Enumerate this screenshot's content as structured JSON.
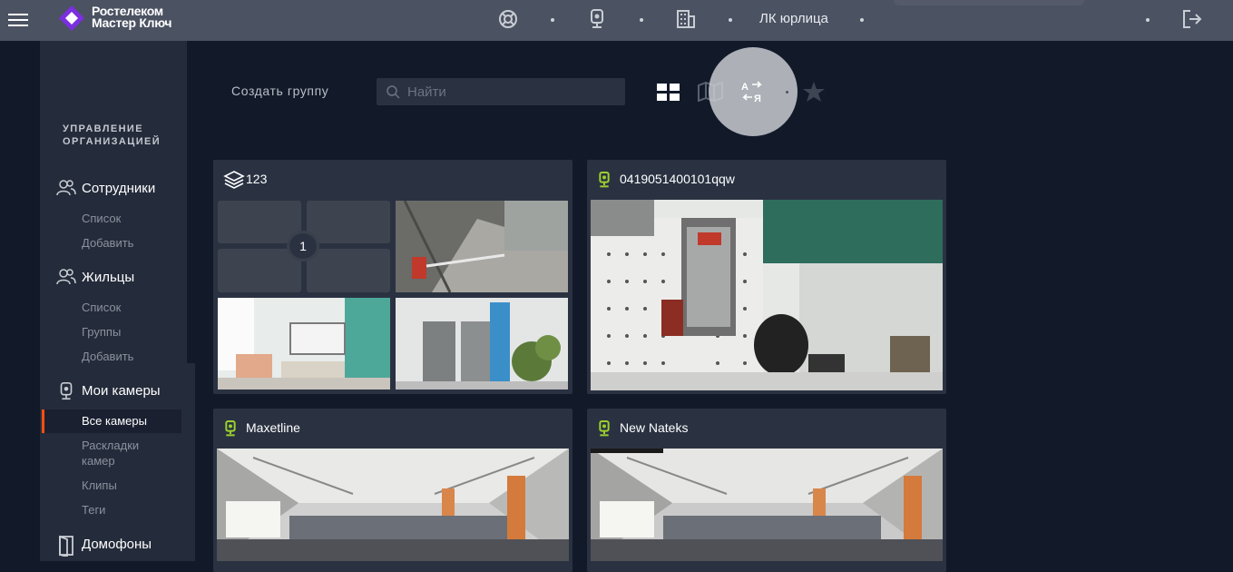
{
  "header": {
    "logo_line1": "Ростелеком",
    "logo_line2": "Мастер Ключ",
    "account_label": "ЛК юрлица",
    "icons": [
      "menu-icon",
      "support-icon",
      "camera-icon",
      "building-icon",
      "logout-icon"
    ]
  },
  "sidebar": {
    "heading": "УПРАВЛЕНИЕ ОРГАНИЗАЦИЕЙ",
    "heading_line1": "УПРАВЛЕНИЕ",
    "heading_line2": "ОРГАНИЗАЦИЕЙ",
    "sections": [
      {
        "label": "Сотрудники",
        "items": [
          "Список",
          "Добавить"
        ]
      },
      {
        "label": "Жильцы",
        "items": [
          "Список",
          "Группы",
          "Добавить"
        ]
      },
      {
        "label": "Мои камеры",
        "items": [
          "Все камеры",
          "Раскладки камер",
          "Клипы",
          "Теги"
        ]
      },
      {
        "label": "Домофоны",
        "items": []
      }
    ],
    "active_item": "Все камеры",
    "layouts_line1": "Раскладки",
    "layouts_line2": "камер"
  },
  "toolbar": {
    "create_group": "Создать группу",
    "search_placeholder": "Найти",
    "view_icons": [
      "grid-view-icon",
      "map-view-icon",
      "sort-alpha-icon",
      "favorite-star-icon"
    ]
  },
  "cards": [
    {
      "title": "123",
      "type": "group",
      "count": "1"
    },
    {
      "title": "0419051400101qqw",
      "type": "camera"
    },
    {
      "title": "Maxetline",
      "type": "camera"
    },
    {
      "title": "New Nateks",
      "type": "camera"
    }
  ],
  "colors": {
    "topbar": "#4b5262",
    "sidebar": "#242b3a",
    "background": "#121a2a",
    "card": "#2a3242",
    "accent": "#ff4f12",
    "camera_green": "#9ccf2e"
  }
}
